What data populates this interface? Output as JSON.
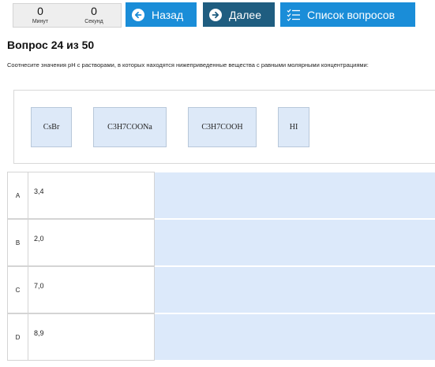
{
  "timer": {
    "minutes_value": "0",
    "minutes_label": "Минут",
    "seconds_value": "0",
    "seconds_label": "Секунд"
  },
  "toolbar": {
    "back_label": "Назад",
    "next_label": "Далее",
    "list_label": "Список вопросов"
  },
  "question": {
    "title": "Вопрос 24 из 50",
    "text": "Соотнесите значения pH с растворами, в которых находятся нижеприведенные вещества с равными молярными концентрациями:"
  },
  "choices": [
    {
      "label": "CsBr"
    },
    {
      "label": "C3H7COONa"
    },
    {
      "label": "C3H7COOH"
    },
    {
      "label": "HI"
    }
  ],
  "rows": [
    {
      "letter": "A",
      "value": "3,4"
    },
    {
      "letter": "B",
      "value": "2,0"
    },
    {
      "letter": "C",
      "value": "7,0"
    },
    {
      "letter": "D",
      "value": "8,9"
    }
  ],
  "colors": {
    "button_primary": "#1a8dd8",
    "button_active": "#1f5d80",
    "drop_zone": "#dce9fa",
    "choice_bg": "#dde9f8"
  }
}
